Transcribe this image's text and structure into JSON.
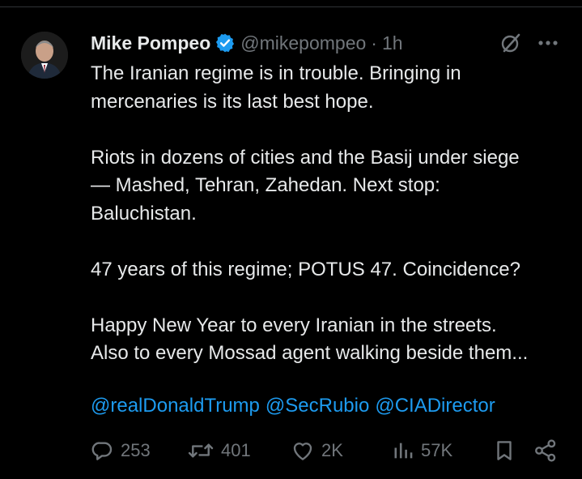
{
  "tweet": {
    "author_name": "Mike Pompeo",
    "handle": "@mikepompeo",
    "separator": "·",
    "time": "1h",
    "paragraphs": [
      [
        "The Iranian regime is in trouble. Bringing in",
        "mercenaries is its last best hope."
      ],
      [
        "Riots in dozens of cities and the Basij under siege",
        "— Mashed, Tehran, Zahedan.  Next stop:",
        "Baluchistan."
      ],
      [
        "47 years of this regime; POTUS 47.  Coincidence?"
      ],
      [
        "Happy New Year to every Iranian in the streets.",
        "Also to every Mossad agent walking beside them..."
      ]
    ],
    "mentions": [
      "@realDonaldTrump",
      "@SecRubio",
      "@CIADirector"
    ]
  },
  "actions": {
    "replies": "253",
    "reposts": "401",
    "likes": "2K",
    "views": "57K"
  },
  "icons": {
    "verified": "verified-badge-icon",
    "grok": "grok-icon",
    "more": "more-icon",
    "reply": "reply-icon",
    "repost": "repost-icon",
    "like": "heart-icon",
    "views": "views-icon",
    "bookmark": "bookmark-icon",
    "share": "share-icon"
  },
  "colors": {
    "background": "#000000",
    "text": "#e7e9ea",
    "muted": "#71767b",
    "accent": "#1d9bf0"
  }
}
